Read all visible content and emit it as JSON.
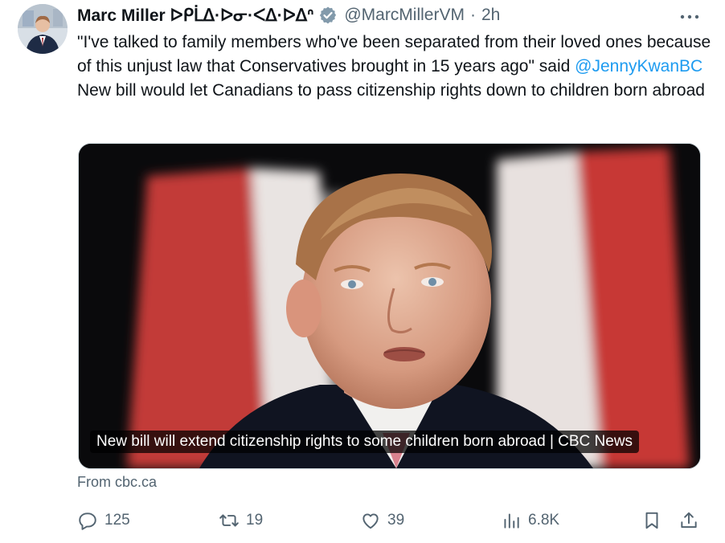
{
  "author": {
    "name": "Marc Miller ᐅᑭᒫᐃ·ᐅᓂ·ᐸᐃ·ᐅᐃᐢ",
    "handle": "@MarcMillerVM",
    "separator": "·",
    "time": "2h",
    "verified_icon": "verified-badge-icon"
  },
  "tweet": {
    "text_before": "\"I've talked to family members who've been separated from their loved ones because of this unjust law that Conservatives brought in 15 years ago\" said ",
    "mention": "@JennyKwanBC",
    "text_after": " New bill would let Canadians to pass citizenship rights down to children born abroad"
  },
  "card": {
    "caption": "New bill will extend citizenship rights to some children born abroad | CBC News",
    "source": "From cbc.ca"
  },
  "actions": {
    "reply_count": "125",
    "retweet_count": "19",
    "like_count": "39",
    "views_count": "6.8K"
  },
  "colors": {
    "accent": "#1d9bf0",
    "muted": "#536471",
    "text": "#0f1419"
  }
}
